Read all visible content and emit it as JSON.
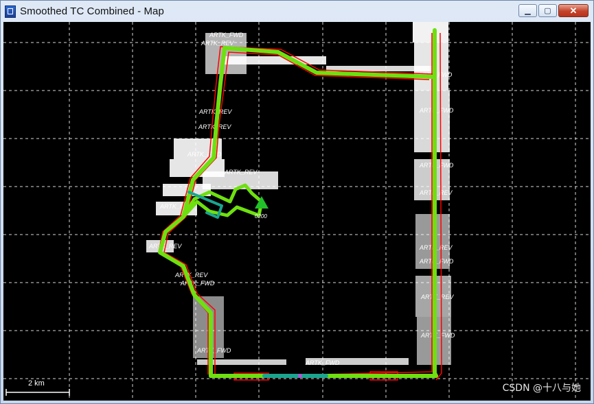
{
  "window": {
    "title": "Smoothed TC Combined - Map",
    "icon": "map-window-icon",
    "buttons": {
      "minimize": "minimize-icon",
      "maximize": "maximize-icon",
      "close": "close-icon"
    }
  },
  "map": {
    "background": "#000000",
    "grid_color": "#ffffff",
    "route_color": "#6ee010",
    "route_alt_color": "#1aa58f",
    "error_color": "#ff0000",
    "label_color": "#ffffff",
    "start_marker_color": "#22c02a",
    "start_label": "0200",
    "scale_label": "2 km",
    "fwd_label": "ARTK_FWD",
    "rev_label": "ARTK_REV"
  },
  "watermark": "CSDN @十八与她"
}
